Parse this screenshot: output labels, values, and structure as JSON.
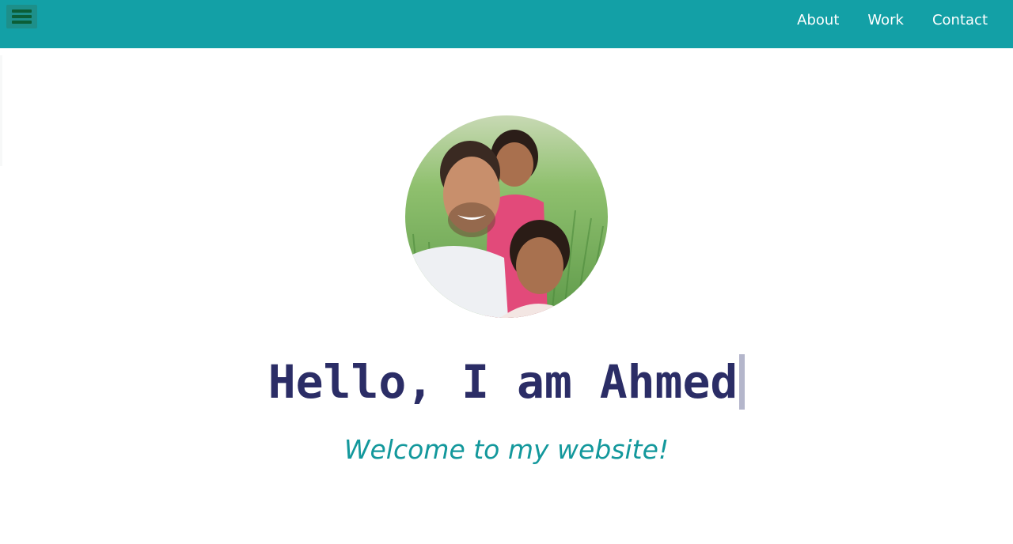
{
  "header": {
    "menu_icon": "hamburger-menu-icon",
    "nav": [
      {
        "label": "About"
      },
      {
        "label": "Work"
      },
      {
        "label": "Contact"
      }
    ]
  },
  "hero": {
    "avatar_icon": "profile-photo",
    "title": "Hello, I am Ahmed",
    "subtitle": "Welcome to my website!"
  },
  "colors": {
    "navbar": "#13a0a6",
    "title": "#2b2d66",
    "subtitle": "#13989c",
    "menu_icon": "#0b5e37"
  }
}
